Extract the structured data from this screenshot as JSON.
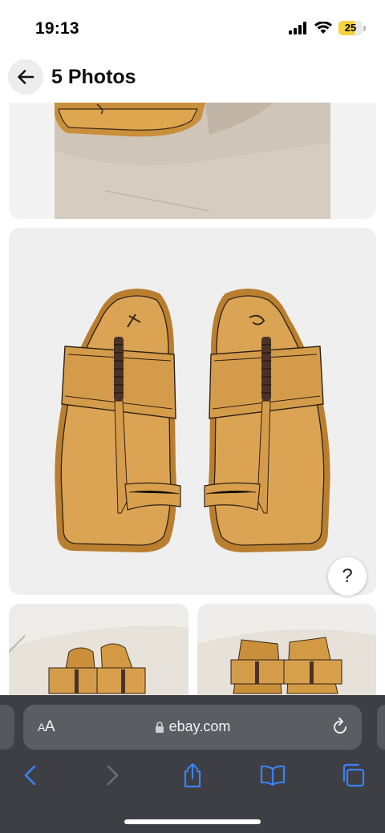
{
  "status_bar": {
    "time": "19:13",
    "battery_level": "25",
    "battery_fraction": 0.25,
    "icons": [
      "signal-bars-icon",
      "wifi-icon",
      "battery-icon"
    ]
  },
  "header": {
    "title": "5 Photos",
    "back_icon": "arrow-left-icon"
  },
  "gallery": {
    "photos": [
      {
        "subject": "sandal-sole-on-sand-photo"
      },
      {
        "subject": "pair-of-tan-leather-toe-ring-sandals-photo"
      },
      {
        "subject": "sandals-on-cushion-photo"
      },
      {
        "subject": "sandals-on-cushion-alt-photo"
      }
    ],
    "help_label": "?"
  },
  "browser": {
    "text_size_label_small": "A",
    "text_size_label_large": "A",
    "url": "ebay.com",
    "lock_icon": "lock-icon",
    "reload_icon": "reload-icon",
    "nav_icons": [
      "back-chevron-icon",
      "forward-chevron-icon",
      "share-icon",
      "bookmarks-icon",
      "tabs-icon"
    ]
  },
  "colors": {
    "accent_blue": "#3b82f6",
    "toolbar_bg": "#3d3f45",
    "battery_yellow": "#f6d33c",
    "sandal_tan": "#d9a34a"
  }
}
